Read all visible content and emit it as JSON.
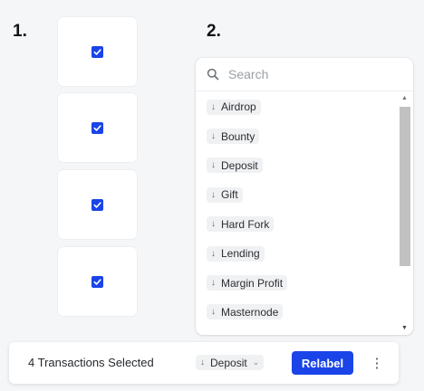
{
  "steps": {
    "one": "1.",
    "two": "2."
  },
  "cards": [
    {
      "checked": true
    },
    {
      "checked": true
    },
    {
      "checked": true
    },
    {
      "checked": true
    }
  ],
  "colors": {
    "accent": "#1a44e8",
    "pill_bg": "#f0f1f3",
    "page_bg": "#f5f6f8"
  },
  "dropdown": {
    "search_placeholder": "Search",
    "items": [
      {
        "icon": "arrow-down-icon",
        "label": "Airdrop"
      },
      {
        "icon": "arrow-down-icon",
        "label": "Bounty"
      },
      {
        "icon": "arrow-down-icon",
        "label": "Deposit"
      },
      {
        "icon": "arrow-down-icon",
        "label": "Gift"
      },
      {
        "icon": "arrow-down-icon",
        "label": "Hard Fork"
      },
      {
        "icon": "arrow-down-icon",
        "label": "Lending"
      },
      {
        "icon": "arrow-down-icon",
        "label": "Margin Profit"
      },
      {
        "icon": "arrow-down-icon",
        "label": "Masternode"
      }
    ]
  },
  "action_bar": {
    "selected_text": "4 Transactions Selected",
    "label_value": "Deposit",
    "relabel_label": "Relabel",
    "more_icon": "more-vertical-icon"
  }
}
